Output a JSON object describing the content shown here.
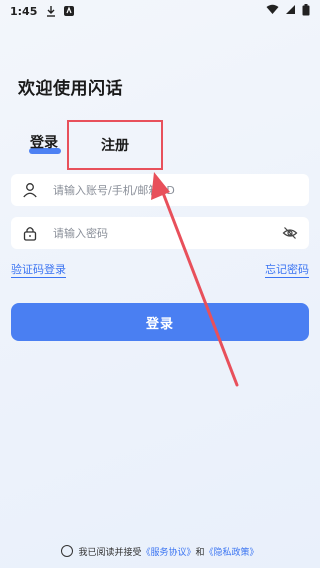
{
  "status_bar": {
    "time": "1:45"
  },
  "welcome": "欢迎使用闪话",
  "tabs": {
    "login": "登录",
    "register": "注册"
  },
  "form": {
    "account_placeholder": "请输入账号/手机/邮箱/ID",
    "password_placeholder": "请输入密码"
  },
  "links": {
    "sms_login": "验证码登录",
    "forgot_password": "忘记密码"
  },
  "login_button": "登录",
  "agreement": {
    "prefix": "我已阅读并接受",
    "terms": "《服务协议》",
    "and": "和",
    "privacy": "《隐私政策》"
  },
  "colors": {
    "accent": "#3b74f2",
    "button": "#4a7ff2",
    "annotation": "#e8505b"
  },
  "icons": {
    "download": "download-icon",
    "app_notification": "app-notification-icon",
    "wifi": "wifi-icon",
    "signal": "signal-icon",
    "battery": "battery-icon",
    "user": "user-icon",
    "lock": "lock-icon",
    "eye_off": "eye-off-icon"
  }
}
